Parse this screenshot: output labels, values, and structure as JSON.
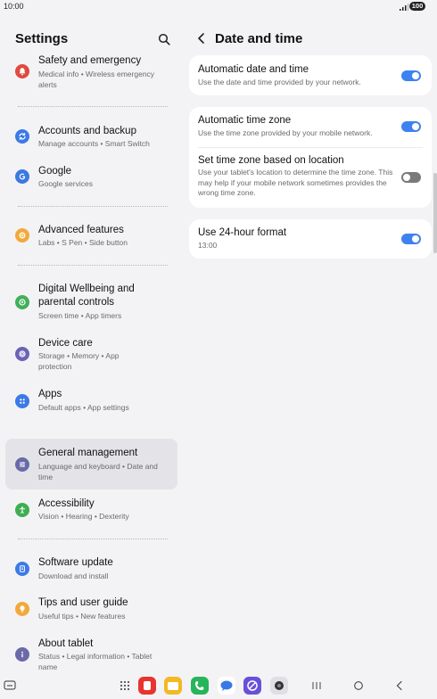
{
  "status": {
    "time": "10:00",
    "battery": "100"
  },
  "left": {
    "title": "Settings",
    "items": [
      {
        "label": "Safety and emergency",
        "sub": "Medical info  •  Wireless emergency alerts",
        "icon": "bell-icon",
        "color": "#e04a3f"
      },
      {
        "label": "Accounts and backup",
        "sub": "Manage accounts  •  Smart Switch",
        "icon": "sync-icon",
        "color": "#3c7ae6"
      },
      {
        "label": "Google",
        "sub": "Google services",
        "icon": "google-icon",
        "color": "#3b79e0"
      },
      {
        "label": "Advanced features",
        "sub": "Labs  •  S Pen  •  Side button",
        "icon": "gear-plus-icon",
        "color": "#f2a93b"
      },
      {
        "label": "Digital Wellbeing and parental controls",
        "sub": "Screen time  •  App timers",
        "icon": "wellbeing-icon",
        "color": "#41b05a"
      },
      {
        "label": "Device care",
        "sub": "Storage  •  Memory  •  App protection",
        "icon": "device-care-icon",
        "color": "#6a63b6"
      },
      {
        "label": "Apps",
        "sub": "Default apps  •  App settings",
        "icon": "apps-icon",
        "color": "#3c7ae6"
      },
      {
        "label": "General management",
        "sub": "Language and keyboard  •  Date and time",
        "icon": "sliders-icon",
        "color": "#6b6aa8"
      },
      {
        "label": "Accessibility",
        "sub": "Vision  •  Hearing  •  Dexterity",
        "icon": "accessibility-icon",
        "color": "#3fae52"
      },
      {
        "label": "Software update",
        "sub": "Download and install",
        "icon": "update-icon",
        "color": "#3c7ae6"
      },
      {
        "label": "Tips and user guide",
        "sub": "Useful tips  •  New features",
        "icon": "lightbulb-icon",
        "color": "#f2a93b"
      },
      {
        "label": "About tablet",
        "sub": "Status  •  Legal information  •  Tablet name",
        "icon": "info-icon",
        "color": "#6b6aa8"
      }
    ]
  },
  "right": {
    "title": "Date and time",
    "rows": [
      {
        "label": "Automatic date and time",
        "sub": "Use the date and time provided by your network.",
        "on": true
      },
      {
        "label": "Automatic time zone",
        "sub": "Use the time zone provided by your mobile network.",
        "on": true
      },
      {
        "label": "Set time zone based on location",
        "sub": "Use your tablet's location to determine the time zone. This may help if your mobile network sometimes provides the wrong time zone.",
        "on": false
      },
      {
        "label": "Use 24-hour format",
        "sub": "13:00",
        "on": true
      }
    ]
  },
  "nav": {
    "dock_apps": [
      "app-drawer-icon",
      "camera-app-icon",
      "my-files-icon",
      "phone-icon",
      "messages-icon",
      "internet-icon",
      "camera-icon"
    ],
    "colors": {
      "toggle_on": "#3e82f0",
      "active_bg": "#e4e4e8"
    }
  }
}
